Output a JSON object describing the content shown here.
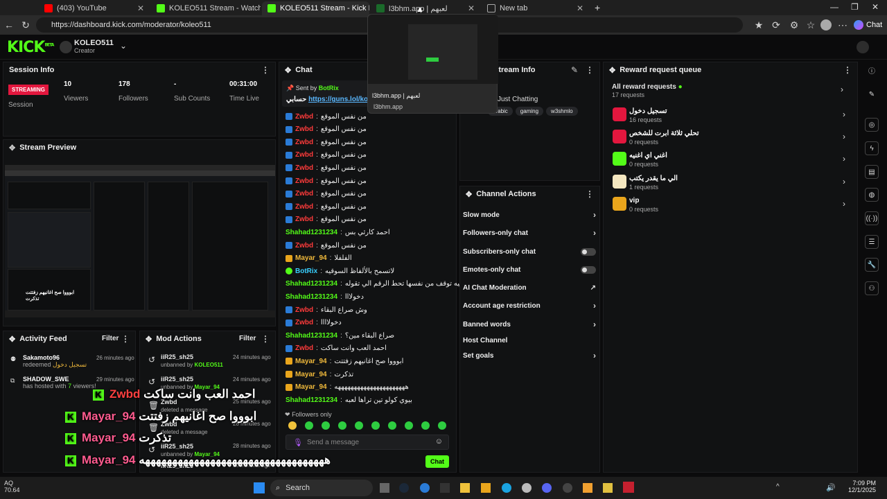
{
  "browser": {
    "tabs": [
      {
        "label": "(403) YouTube",
        "color": "#ff0000"
      },
      {
        "label": "KOLEO511 Stream - Watch Live o",
        "color": "#53fc18"
      },
      {
        "label": "KOLEO511 Stream - Kick Dashbo",
        "color": "#53fc18"
      },
      {
        "label": "l3bhm.app | لعبهم",
        "color": "#53fc18"
      },
      {
        "label": "New tab",
        "color": "#888888"
      }
    ],
    "url": "https://dashboard.kick.com/moderator/koleo511",
    "chat_button": "Chat",
    "tab_preview_title": "l3bhm.app | لعبهم",
    "tab_preview_url": "l3bhm.app"
  },
  "header": {
    "logo": "KICK",
    "logo_sup": "BETA",
    "channel": "KOLEO511",
    "role": "Creator"
  },
  "session": {
    "title": "Session Info",
    "status": "STREAMING",
    "status_label": "Session",
    "viewers": "10",
    "viewers_label": "Viewers",
    "followers": "178",
    "followers_label": "Followers",
    "subs": "-",
    "subs_label": "Sub Counts",
    "time": "00:31:00",
    "time_label": "Time Live"
  },
  "preview": {
    "title": "Stream Preview"
  },
  "activity": {
    "title": "Activity Feed",
    "filter": "Filter",
    "items": [
      {
        "user": "Sakamoto96",
        "text": "redeemed",
        "reward": "تسجيل دخول",
        "time": "26 minutes ago"
      },
      {
        "user": "SHADOW_SWE",
        "text": "has hosted with",
        "count": "7",
        "suffix": "viewers!",
        "time": "29 minutes ago"
      }
    ]
  },
  "mod": {
    "title": "Mod Actions",
    "filter": "Filter",
    "items": [
      {
        "user": "iiR25_sh25",
        "action": "unbanned by",
        "by": "KOLEO511",
        "time": "24 minutes ago"
      },
      {
        "user": "iiR25_sh25",
        "action": "unbanned by",
        "by": "Mayar_94",
        "time": "24 minutes ago"
      },
      {
        "user": "Zwbd",
        "action": "deleted a message",
        "by": "",
        "time": "25 minutes ago"
      },
      {
        "user": "Zwbd",
        "action": "deleted a message",
        "by": "",
        "time": "28 minutes ago"
      },
      {
        "user": "iiR25_sh25",
        "action": "unbanned by",
        "by": "Mayar_94",
        "time": "28 minutes ago"
      },
      {
        "user": "iiR25_sh25",
        "action": "",
        "by": "",
        "time": "28 minutes ago"
      }
    ]
  },
  "chat": {
    "title": "Chat",
    "pinned_by": "Sent by",
    "pinned_user": "BotRix",
    "pinned_text": "حسابي",
    "pinned_link": "https://guns.lol/koleo",
    "messages": [
      {
        "user": "Zwbd",
        "text": "من نفس الموقع",
        "color": "red",
        "badge": "blue"
      },
      {
        "user": "Zwbd",
        "text": "من نفس الموقع",
        "color": "red",
        "badge": "blue"
      },
      {
        "user": "Zwbd",
        "text": "من نفس الموقع",
        "color": "red",
        "badge": "blue"
      },
      {
        "user": "Zwbd",
        "text": "من نفس الموقع",
        "color": "red",
        "badge": "blue"
      },
      {
        "user": "Zwbd",
        "text": "من نفس الموقع",
        "color": "red",
        "badge": "blue"
      },
      {
        "user": "Zwbd",
        "text": "من نفس الموقع",
        "color": "red",
        "badge": "blue"
      },
      {
        "user": "Zwbd",
        "text": "من نفس الموقع",
        "color": "red",
        "badge": "blue"
      },
      {
        "user": "Zwbd",
        "text": "من نفس الموقع",
        "color": "red",
        "badge": "blue"
      },
      {
        "user": "Zwbd",
        "text": "من نفس الموقع",
        "color": "red",
        "badge": "blue"
      },
      {
        "user": "Shahad1231234",
        "text": "احمد كارثي بس",
        "color": "green",
        "badge": ""
      },
      {
        "user": "Zwbd",
        "text": "من نفس الموقع",
        "color": "red",
        "badge": "blue"
      },
      {
        "user": "Mayar_94",
        "text": "الفلفلا",
        "color": "gold",
        "badge": "gold"
      },
      {
        "user": "BotRix",
        "text": "لاتسمح بالألفاظ السوقيه",
        "color": "cyan",
        "badge": "green"
      },
      {
        "user": "Shahad1231234",
        "text": "تحط دخول ولما الاعبيه توقف من نفسها تحط الرقم الي تقوله",
        "color": "green",
        "badge": ""
      },
      {
        "user": "Shahad1231234",
        "text": "دخولااا",
        "color": "green",
        "badge": ""
      },
      {
        "user": "Zwbd",
        "text": "وش صراع البقاء",
        "color": "red",
        "badge": "blue"
      },
      {
        "user": "Zwbd",
        "text": "دخولاااا",
        "color": "red",
        "badge": "blue"
      },
      {
        "user": "Shahad1231234",
        "text": "صراع البقاء مين؟",
        "color": "green",
        "badge": ""
      },
      {
        "user": "Zwbd",
        "text": "احمد العب وانت ساكت",
        "color": "red",
        "badge": "blue"
      },
      {
        "user": "Mayar_94",
        "text": "ابوووا صح اغانيهم زفتتت",
        "color": "gold",
        "badge": "gold"
      },
      {
        "user": "Mayar_94",
        "text": "تذكرت",
        "color": "gold",
        "badge": "gold"
      },
      {
        "user": "Mayar_94",
        "text": "ههههههههههههههههههههههه",
        "color": "gold",
        "badge": "gold"
      },
      {
        "user": "Shahad1231234",
        "text": "بيوي كولو تين تراها لعبه",
        "color": "green",
        "badge": ""
      }
    ],
    "followers_only": "Followers only",
    "placeholder": "Send a message"
  },
  "stream_info": {
    "title": "Stream Info",
    "category": "Just Chatting",
    "tags": [
      "arabic",
      "gaming",
      "w3shmlo"
    ]
  },
  "actions": {
    "title": "Channel Actions",
    "items": [
      {
        "label": "Slow mode",
        "kind": "chevron"
      },
      {
        "label": "Followers-only chat",
        "kind": "chevron"
      },
      {
        "label": "Subscribers-only chat",
        "kind": "toggle"
      },
      {
        "label": "Emotes-only chat",
        "kind": "toggle"
      },
      {
        "label": "AI Chat Moderation",
        "kind": "external"
      },
      {
        "label": "Account age restriction",
        "kind": "chevron"
      },
      {
        "label": "Banned words",
        "kind": "chevron"
      },
      {
        "label": "Host Channel",
        "kind": "none"
      },
      {
        "label": "Set goals",
        "kind": "chevron"
      }
    ]
  },
  "rewards": {
    "title": "Reward request queue",
    "all_label": "All reward requests",
    "all_count": "17 requests",
    "items": [
      {
        "title": "تسجيل دخول",
        "count": "16 requests",
        "color": "#e3173e"
      },
      {
        "title": "تحلي ثلاثة ابرت للشخص",
        "count": "0 requests",
        "color": "#e3173e"
      },
      {
        "title": "اغني اي اغنيه",
        "count": "0 requests",
        "color": "#53fc18"
      },
      {
        "title": "الي ما يقدر يكتب",
        "count": "1 requests",
        "color": "#f4e7c0"
      },
      {
        "title": "vip",
        "count": "0 requests",
        "color": "#e9a51c"
      }
    ]
  },
  "overlay": [
    {
      "user": "Zwbd",
      "text": "احمد العب وانت ساكت",
      "color": "#ff4040"
    },
    {
      "user": "Mayar_94",
      "text": "ابوووا صح اغانيهم زفتتت",
      "color": "#ff5b8f"
    },
    {
      "user": "Mayar_94",
      "text": "تذكرت",
      "color": "#ff5b8f"
    },
    {
      "user": "Mayar_94",
      "text": "ههههههههههههههههههههههههههههههههههه",
      "color": "#ff5b8f"
    },
    {
      "user": "Shahad1231234",
      "text": "بيوي كولو تين تراها لعبه",
      "color": "#53fc18"
    }
  ],
  "taskbar": {
    "search": "Search",
    "time": "7:09 PM",
    "date": "12/1/2025",
    "aq": "AQ",
    "aq_value": "70.64"
  }
}
